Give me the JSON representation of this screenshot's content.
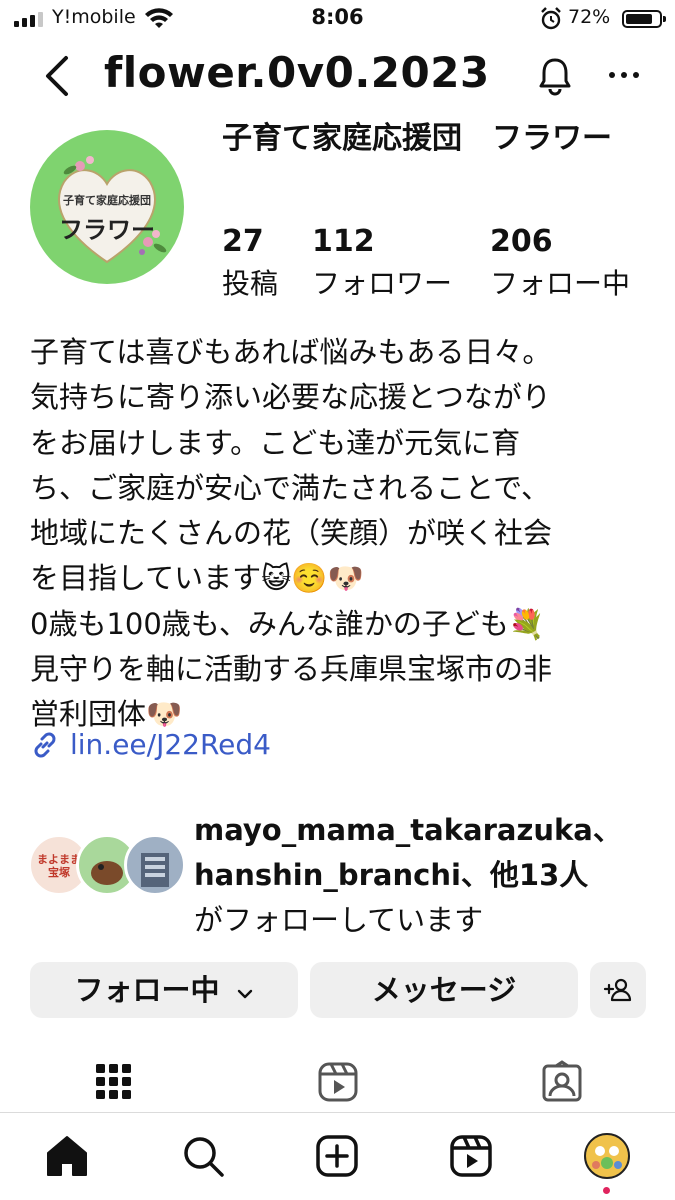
{
  "status_bar": {
    "carrier": "Y!mobile",
    "time": "8:06",
    "battery": "72%"
  },
  "header": {
    "username": "flower.0v0.2023"
  },
  "profile": {
    "avatar_line1": "子育て家庭応援団",
    "avatar_line2": "フラワー",
    "display_name": "子育て家庭応援団　フラワー",
    "stats": [
      {
        "value": "27",
        "label": "投稿"
      },
      {
        "value": "112",
        "label": "フォロワー"
      },
      {
        "value": "206",
        "label": "フォロー中"
      }
    ],
    "bio": "子育ては喜びもあれば悩みもある日々。\n気持ちに寄り添い必要な応援とつながり\nをお届けします。こども達が元気に育\nち、ご家庭が安心で満たされることで、\n地域にたくさんの花（笑顔）が咲く社会\nを目指しています😺☺️🐶\n0歳も100歳も、みんな誰かの子ども💐\n見守りを軸に活動する兵庫県宝塚市の非\n営利団体🐶",
    "link": "lin.ee/J22Red4"
  },
  "followed_by": {
    "mini_avatar_text": "まよまま\n宝塚",
    "names": "mayo_mama_takarazuka、hanshin_branchi、他13人",
    "suffix": "がフォローしています"
  },
  "actions": {
    "following": "フォロー中",
    "message": "メッセージ"
  },
  "icons": {
    "back": "chevron-left-icon",
    "notifications": "bell-icon",
    "more": "ellipsis-icon",
    "link": "link-icon",
    "grid": "grid-icon",
    "reels": "reels-icon",
    "tagged": "tagged-icon",
    "home": "home-icon",
    "search": "search-icon",
    "create": "plus-square-icon",
    "add_person": "add-person-icon"
  },
  "colors": {
    "link": "#3a5bc7",
    "button_bg": "#efefef",
    "avatar_bg": "#7fd36f",
    "notification_dot": "#e0245e"
  }
}
